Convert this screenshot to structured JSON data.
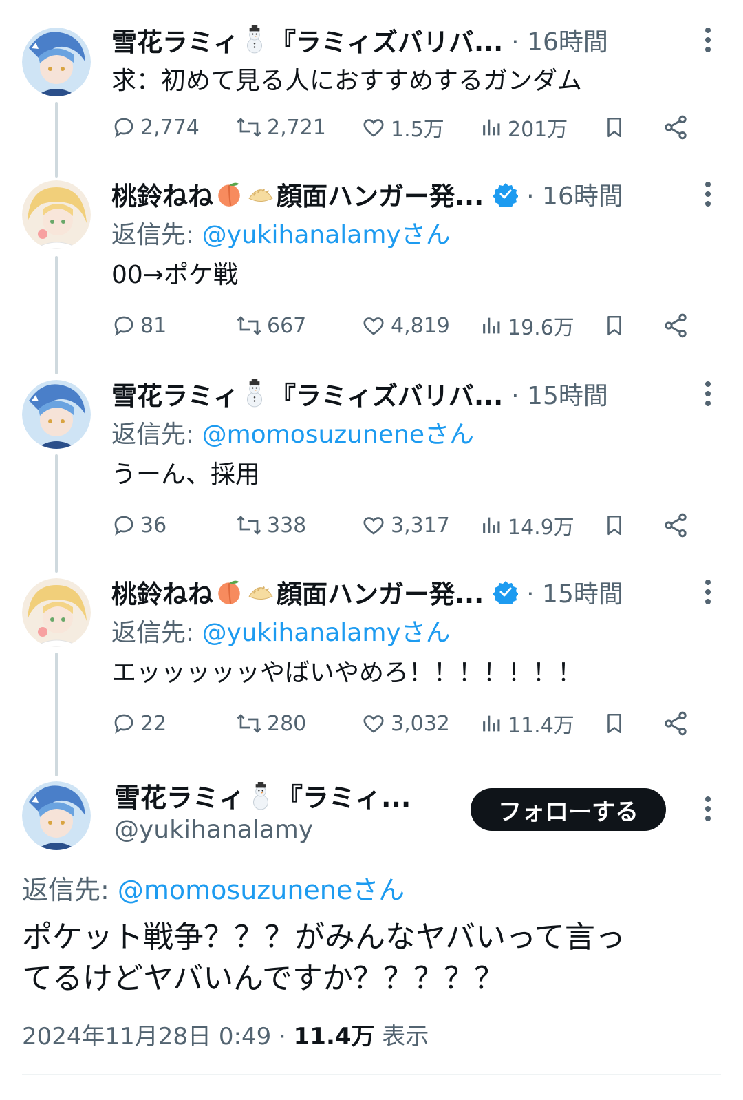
{
  "thread": [
    {
      "name": "雪花ラミィ",
      "name_suffix": "『ラミィズバリバ...",
      "emoji": [
        "snowman"
      ],
      "verified": false,
      "time": "· 16時間",
      "reply_prefix": "",
      "reply_mention": "",
      "reply_suffix": "",
      "text": "求：初めて見る人におすすめするガンダム",
      "replies": "2,774",
      "retweets": "2,721",
      "likes": "1.5万",
      "views": "201万",
      "avatar": "lamy"
    },
    {
      "name": "桃鈴ねね",
      "name_suffix": "顔面ハンガー発...",
      "emoji": [
        "peach",
        "gyoza"
      ],
      "verified": true,
      "time": "· 16時間",
      "reply_prefix": "返信先: ",
      "reply_mention": "@yukihanalamy",
      "reply_suffix": "さん",
      "text": "00→ポケ戦",
      "replies": "81",
      "retweets": "667",
      "likes": "4,819",
      "views": "19.6万",
      "avatar": "nene"
    },
    {
      "name": "雪花ラミィ",
      "name_suffix": "『ラミィズバリバ...",
      "emoji": [
        "snowman"
      ],
      "verified": false,
      "time": "· 15時間",
      "reply_prefix": "返信先: ",
      "reply_mention": "@momosuzunene",
      "reply_suffix": "さん",
      "text": "うーん、採用",
      "replies": "36",
      "retweets": "338",
      "likes": "3,317",
      "views": "14.9万",
      "avatar": "lamy"
    },
    {
      "name": "桃鈴ねね",
      "name_suffix": "顔面ハンガー発...",
      "emoji": [
        "peach",
        "gyoza"
      ],
      "verified": true,
      "time": "· 15時間",
      "reply_prefix": "返信先: ",
      "reply_mention": "@yukihanalamy",
      "reply_suffix": "さん",
      "text": "エッッッッッやばいやめろ！！！！！！！",
      "replies": "22",
      "retweets": "280",
      "likes": "3,032",
      "views": "11.4万",
      "avatar": "nene"
    }
  ],
  "main": {
    "name": "雪花ラミィ",
    "name_suffix": "『ラミィ...",
    "handle": "@yukihanalamy",
    "follow_label": "フォローする",
    "reply_prefix": "返信先: ",
    "reply_mention": "@momosuzunene",
    "reply_suffix": "さん",
    "text_line1": "ポケット戦争？？？がみんなヤバいって言っ",
    "text_line2": "てるけどヤバいんですか？？？？？",
    "date": "2024年11月28日 0:49 · ",
    "views": "11.4万",
    "views_suffix": " 表示"
  },
  "colors": {
    "accent": "#1d9bf0",
    "muted": "#536471",
    "text": "#0f1419",
    "thread_line": "#cfd9de"
  }
}
